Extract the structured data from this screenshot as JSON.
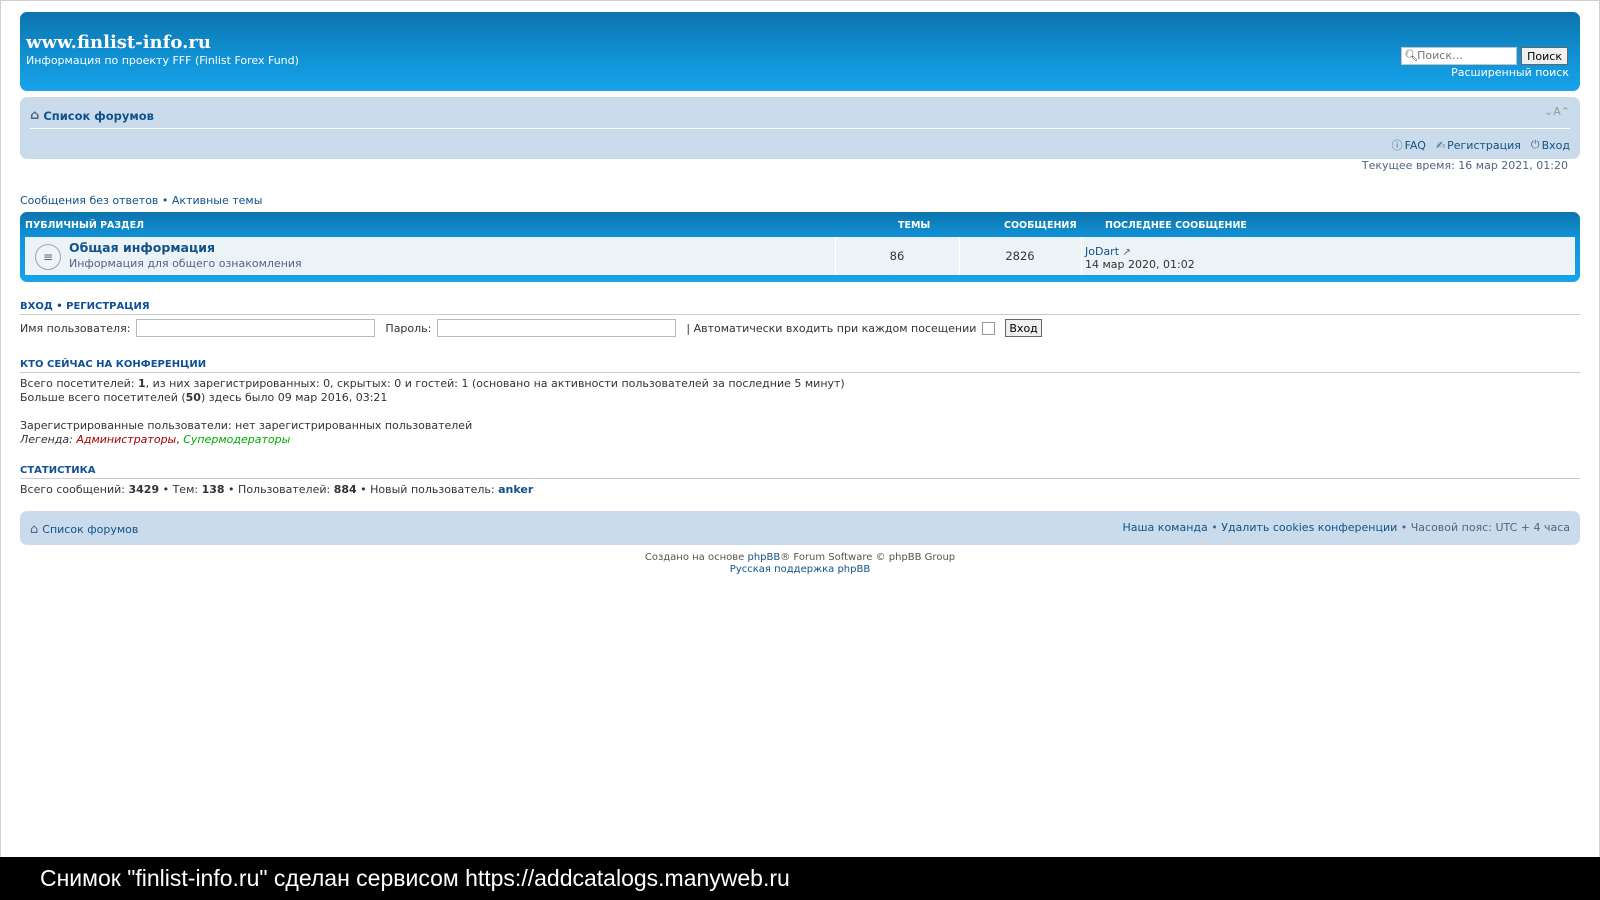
{
  "header": {
    "site_title": "www.finlist-info.ru",
    "site_description": "Информация по проекту FFF (Finlist Forex Fund)",
    "search_placeholder": "Поиск…",
    "search_button": "Поиск",
    "advanced_search": "Расширенный поиск"
  },
  "navbar": {
    "home": "Список форумов",
    "font_size_toggle": "A",
    "links": {
      "faq": "FAQ",
      "register": "Регистрация",
      "login": "Вход"
    }
  },
  "current_time": "Текущее время: 16 мар 2021, 01:20",
  "quick_links": {
    "unanswered": "Сообщения без ответов",
    "sep": " • ",
    "active": "Активные темы"
  },
  "forum_table": {
    "headers": {
      "section": "ПУБЛИЧНЫЙ РАЗДЕЛ",
      "topics": "ТЕМЫ",
      "posts": "СООБЩЕНИЯ",
      "last_post": "ПОСЛЕДНЕЕ СООБЩЕНИЕ"
    },
    "rows": [
      {
        "title": "Общая информация",
        "description": "Информация для общего ознакомления",
        "topics": "86",
        "posts": "2826",
        "last_user": "JoDart",
        "last_date": "14 мар 2020, 01:02"
      }
    ]
  },
  "login": {
    "title_login": "ВХОД",
    "title_sep": " • ",
    "title_register": "РЕГИСТРАЦИЯ",
    "username_label": "Имя пользователя:",
    "password_label": "Пароль:",
    "autologin_label": "| Автоматически входить при каждом посещении",
    "button": "Вход"
  },
  "online": {
    "title": "КТО СЕЙЧАС НА КОНФЕРЕНЦИИ",
    "line1_pre": "Всего посетителей: ",
    "line1_total": "1",
    "line1_post": ", из них зарегистрированных: 0, скрытых: 0 и гостей: 1 (основано на активности пользователей за последние 5 минут)",
    "line2_pre": "Больше всего посетителей (",
    "line2_max": "50",
    "line2_post": ") здесь было 09 мар 2016, 03:21",
    "registered": "Зарегистрированные пользователи: нет зарегистрированных пользователей",
    "legend_label": "Легенда: ",
    "legend_admins": "Администраторы",
    "legend_sep": ", ",
    "legend_smods": "Супермодераторы"
  },
  "stats": {
    "title": "СТАТИСТИКА",
    "posts_label": "Всего сообщений: ",
    "posts": "3429",
    "topics_label": " • Тем: ",
    "topics": "138",
    "users_label": " • Пользователей: ",
    "users": "884",
    "newest_label": " • Новый пользователь: ",
    "newest": "anker"
  },
  "footer": {
    "home": "Список форумов",
    "team": "Наша команда",
    "delete_cookies": "Удалить cookies конференции",
    "timezone": "Часовой пояс: UTC + 4 часа",
    "sep": " • ",
    "powered_pre": "Создано на основе ",
    "powered_link": "phpBB",
    "powered_post": "® Forum Software © phpBB Group",
    "russian_support": "Русская поддержка phpBB"
  },
  "caption": "Снимок \"finlist-info.ru\" сделан сервисом https://addcatalogs.manyweb.ru",
  "colors": {
    "header_blue": "#1193d6",
    "nav_bg": "#cadceb",
    "link": "#105289",
    "admin": "#AA0000",
    "supermod": "#00AA00"
  }
}
